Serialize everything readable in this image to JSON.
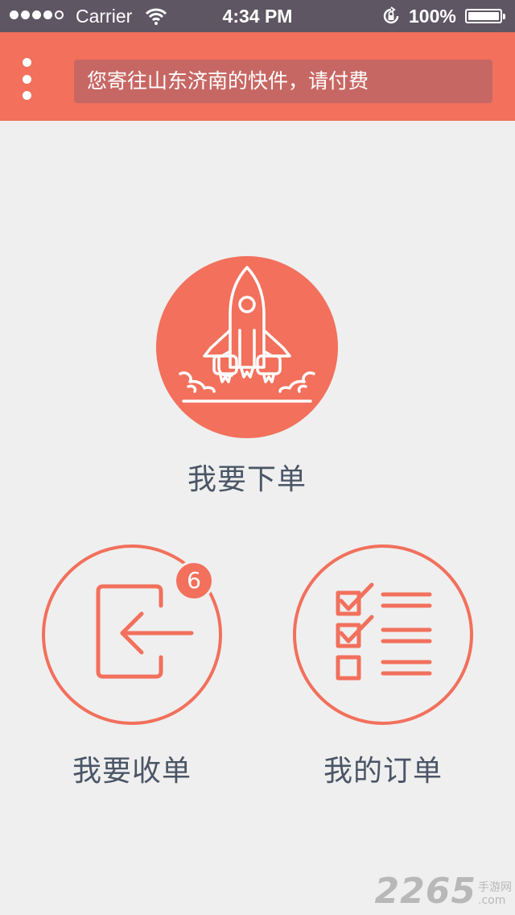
{
  "status_bar": {
    "carrier": "Carrier",
    "time": "4:34 PM",
    "battery": "100%"
  },
  "header": {
    "notice": "您寄往山东济南的快件，请付费"
  },
  "actions": {
    "send_order": {
      "label": "我要下单"
    },
    "receive_order": {
      "label": "我要收单",
      "badge": "6"
    },
    "my_orders": {
      "label": "我的订单"
    }
  },
  "watermark": {
    "brand": "2265",
    "line1": "手游网",
    "line2": ".com"
  },
  "colors": {
    "accent": "#f2705c",
    "label": "#4a5566",
    "status_bar": "#5f5664"
  }
}
